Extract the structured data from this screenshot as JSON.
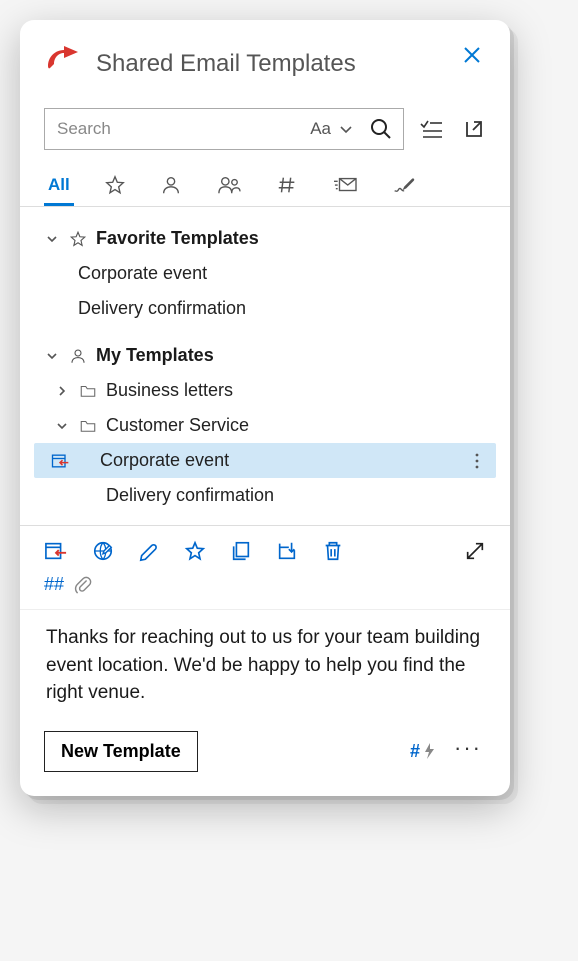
{
  "header": {
    "title": "Shared Email Templates"
  },
  "search": {
    "placeholder": "Search",
    "value": "",
    "case_label": "Aa"
  },
  "tabs": {
    "active": "All",
    "items": [
      "All"
    ]
  },
  "tree": {
    "favorites": {
      "label": "Favorite Templates",
      "expanded": true,
      "items": [
        {
          "label": "Corporate event"
        },
        {
          "label": "Delivery confirmation"
        }
      ]
    },
    "my": {
      "label": "My Templates",
      "expanded": true,
      "folders": [
        {
          "label": "Business letters",
          "expanded": false
        },
        {
          "label": "Customer Service",
          "expanded": true,
          "items": [
            {
              "label": "Corporate event",
              "selected": true
            },
            {
              "label": "Delivery confirmation"
            }
          ]
        }
      ]
    }
  },
  "preview": {
    "hash_label": "##",
    "body": "Thanks for reaching out to us for your team building event location. We'd be happy to help you find the right venue."
  },
  "footer": {
    "new_template_label": "New Template",
    "hash_action": "#"
  }
}
